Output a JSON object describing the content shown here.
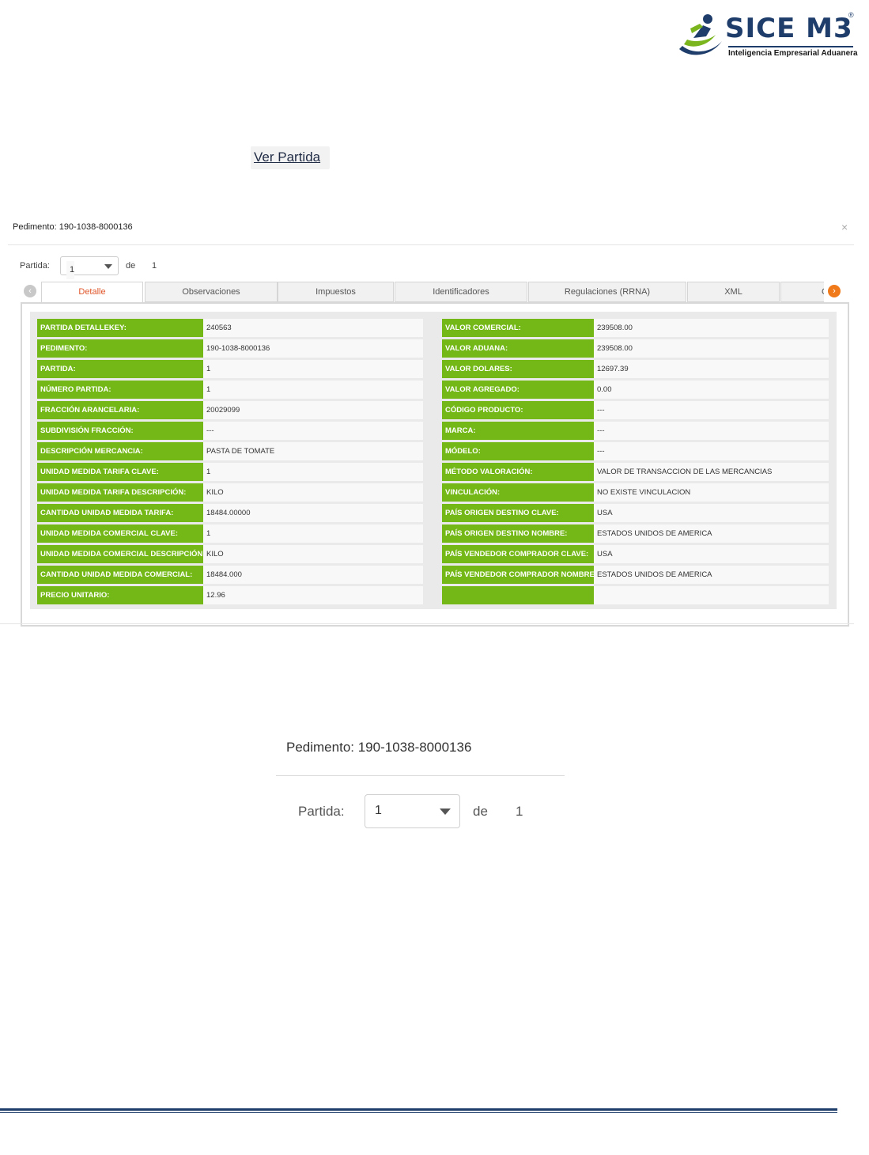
{
  "logo": {
    "brand": "SICE M3",
    "registered": "®",
    "tagline": "Inteligencia Empresarial Aduanera"
  },
  "ver_partida": "Ver Partida",
  "modal": {
    "title": "Pedimento: 190-1038-8000136",
    "close": "×",
    "partida_label": "Partida:",
    "partida_value": "1",
    "de_label": "de",
    "de_value": "1",
    "tabs": [
      "Detalle",
      "Observaciones",
      "Impuestos",
      "Identificadores",
      "Regulaciones (RRNA)",
      "XML",
      "C"
    ],
    "left_fields": [
      {
        "label": "PARTIDA DETALLEKEY:",
        "value": "240563"
      },
      {
        "label": "PEDIMENTO:",
        "value": "190-1038-8000136"
      },
      {
        "label": "PARTIDA:",
        "value": "1"
      },
      {
        "label": "NÚMERO PARTIDA:",
        "value": "1"
      },
      {
        "label": "FRACCIÓN ARANCELARIA:",
        "value": "20029099"
      },
      {
        "label": "SUBDIVISIÓN FRACCIÓN:",
        "value": "---"
      },
      {
        "label": "DESCRIPCIÓN MERCANCIA:",
        "value": "PASTA DE TOMATE"
      },
      {
        "label": "UNIDAD MEDIDA TARIFA CLAVE:",
        "value": "1"
      },
      {
        "label": "UNIDAD MEDIDA TARIFA DESCRIPCIÓN:",
        "value": "KILO"
      },
      {
        "label": "CANTIDAD UNIDAD MEDIDA TARIFA:",
        "value": "18484.00000"
      },
      {
        "label": "UNIDAD MEDIDA COMERCIAL CLAVE:",
        "value": "1"
      },
      {
        "label": "UNIDAD MEDIDA COMERCIAL DESCRIPCIÓN:",
        "value": "KILO"
      },
      {
        "label": "CANTIDAD UNIDAD MEDIDA COMERCIAL:",
        "value": "18484.000"
      },
      {
        "label": "PRECIO UNITARIO:",
        "value": "12.96"
      }
    ],
    "right_fields": [
      {
        "label": "VALOR COMERCIAL:",
        "value": "239508.00"
      },
      {
        "label": "VALOR ADUANA:",
        "value": "239508.00"
      },
      {
        "label": "VALOR DOLARES:",
        "value": "12697.39"
      },
      {
        "label": "VALOR AGREGADO:",
        "value": "0.00"
      },
      {
        "label": "CÓDIGO PRODUCTO:",
        "value": "---"
      },
      {
        "label": "MARCA:",
        "value": "---"
      },
      {
        "label": "MÓDELO:",
        "value": "---"
      },
      {
        "label": "MÉTODO VALORACIÓN:",
        "value": "VALOR DE TRANSACCION DE LAS MERCANCIAS"
      },
      {
        "label": "VINCULACIÓN:",
        "value": "NO EXISTE VINCULACION"
      },
      {
        "label": "PAÍS ORIGEN DESTINO CLAVE:",
        "value": "USA"
      },
      {
        "label": "PAÍS ORIGEN DESTINO NOMBRE:",
        "value": "ESTADOS UNIDOS DE AMERICA"
      },
      {
        "label": "PAÍS VENDEDOR COMPRADOR CLAVE:",
        "value": "USA"
      },
      {
        "label": "PAÍS VENDEDOR COMPRADOR NOMBRE:",
        "value": "ESTADOS UNIDOS DE AMERICA"
      },
      {
        "label": "",
        "value": ""
      }
    ]
  },
  "zoom": {
    "title": "Pedimento: 190-1038-8000136",
    "partida_label": "Partida:",
    "partida_value": "1",
    "de_label": "de",
    "de_value": "1"
  },
  "colors": {
    "label_green": "#73b816",
    "active_tab": "#e0562a",
    "next_arrow": "#f07a1a",
    "brand_blue": "#1f3d6b"
  }
}
